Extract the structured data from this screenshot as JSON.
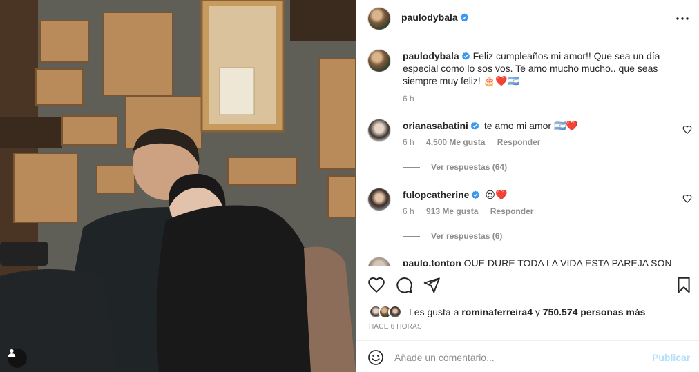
{
  "post": {
    "author": "paulodybala",
    "author_verified": true
  },
  "caption": {
    "username": "paulodybala",
    "text": " Feliz cumpleaños mi amor!! Que sea un día especial como lo sos vos. Te amo mucho mucho.. que seas siempre muy feliz! 🎂❤️🇦🇷",
    "time": "6 h"
  },
  "comments": [
    {
      "username": "orianasabatini",
      "verified": true,
      "text": "te amo mi amor 🇦🇷❤️",
      "time": "6 h",
      "likes": "4,500 Me gusta",
      "reply_label": "Responder",
      "view_replies": "Ver respuestas (64)"
    },
    {
      "username": "fulopcatherine",
      "verified": true,
      "text": "😍❤️",
      "time": "6 h",
      "likes": "913 Me gusta",
      "reply_label": "Responder",
      "view_replies": "Ver respuestas (6)"
    }
  ],
  "partial_comment": {
    "username": "paulo.tonton",
    "text": "QUE DURE TODA LA VIDA ESTA PAREJA SON"
  },
  "likes": {
    "prefix": "Les gusta a ",
    "user": "rominaferreira4",
    "middle": " y ",
    "count": "750.574 personas más"
  },
  "timestamp": "HACE 6 HORAS",
  "add_comment": {
    "placeholder": "Añade un comentario...",
    "post_label": "Publicar",
    "post_label_color": "#b2dffc"
  },
  "icons": {
    "verified": "verified-badge-icon",
    "more": "more-options-icon",
    "like": "heart-icon",
    "comment": "comment-bubble-icon",
    "share": "paper-plane-icon",
    "save": "bookmark-icon",
    "emoji": "emoji-smile-icon",
    "tag": "user-tag-icon"
  },
  "colors": {
    "verified_blue": "#3897f0",
    "secondary_text": "#8e8e8e",
    "divider": "#efefef"
  }
}
